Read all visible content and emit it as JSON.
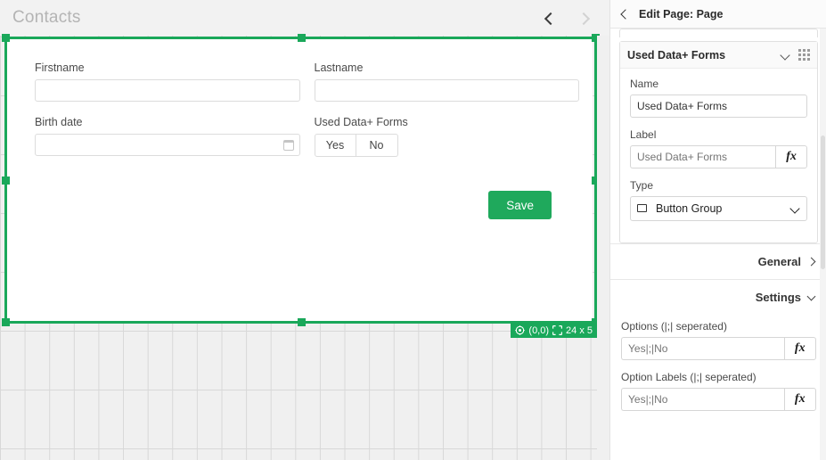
{
  "canvas": {
    "page_title": "Contacts",
    "nav": {
      "prev_icon": "chevron-left-icon",
      "next_icon": "chevron-right-icon"
    },
    "selection": {
      "position_icon": "target-icon",
      "position": "(0,0)",
      "size_icon": "resize-icon",
      "size": "24 x 5"
    },
    "form": {
      "fields": [
        {
          "label": "Firstname",
          "value": "",
          "type": "text"
        },
        {
          "label": "Lastname",
          "value": "",
          "type": "text"
        },
        {
          "label": "Birth date",
          "value": "",
          "type": "date"
        },
        {
          "label": "Used Data+ Forms",
          "type": "buttongroup",
          "options": [
            "Yes",
            "No"
          ]
        }
      ],
      "save_label": "Save"
    }
  },
  "panel": {
    "back_icon": "chevron-left-icon",
    "title": "Edit Page: Page",
    "widget": {
      "title": "Used Data+ Forms",
      "collapse_icon": "chevron-down-icon",
      "drag_icon": "drag-handle-icon",
      "name_label": "Name",
      "name_value": "Used Data+ Forms",
      "label_label": "Label",
      "label_placeholder": "Used Data+ Forms",
      "label_fx": "fx",
      "type_label": "Type",
      "type_value": "Button Group",
      "type_icon": "button-group-icon",
      "type_caret_icon": "chevron-down-icon"
    },
    "sections": [
      {
        "label": "General",
        "icon": "chevron-right-icon",
        "state": "collapsed"
      },
      {
        "label": "Settings",
        "icon": "chevron-down-icon",
        "state": "expanded"
      }
    ],
    "settings": {
      "options_label": "Options (|;| seperated)",
      "options_placeholder": "Yes|;|No",
      "options_fx": "fx",
      "option_labels_label": "Option Labels (|;| seperated)",
      "option_labels_placeholder": "Yes|;|No",
      "option_labels_fx": "fx"
    }
  },
  "colors": {
    "accent_green": "#1fa95c",
    "selection_green": "#1aa85a"
  }
}
